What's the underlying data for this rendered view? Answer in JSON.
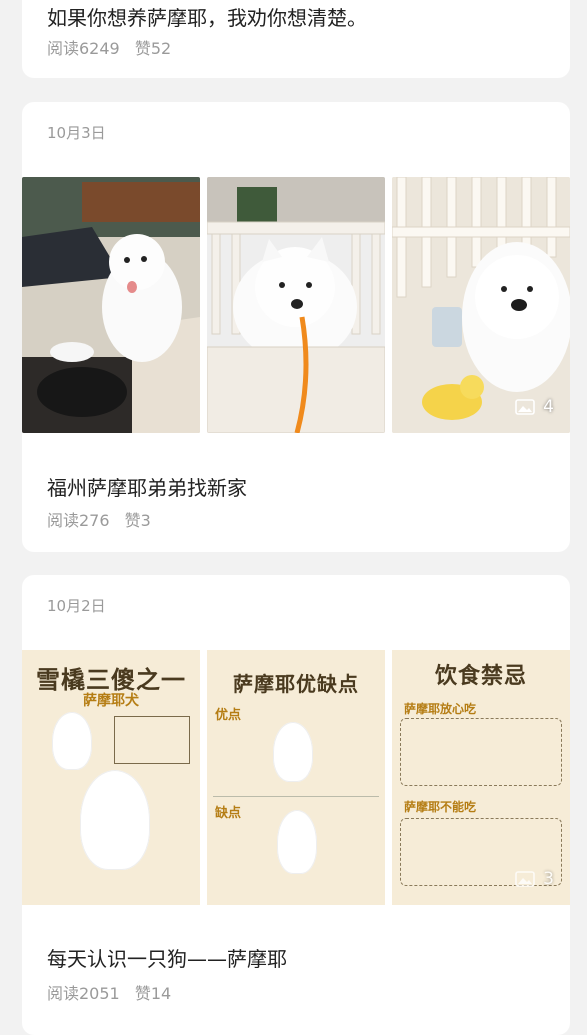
{
  "posts": [
    {
      "title": "如果你想养萨摩耶，我劝你想清楚。",
      "reads": "阅读6249",
      "likes": "赞52"
    },
    {
      "date": "10月3日",
      "title": "福州萨摩耶弟弟找新家",
      "reads": "阅读276",
      "likes": "赞3",
      "image_count": "4"
    },
    {
      "date": "10月2日",
      "title": "每天认识一只狗——萨摩耶",
      "reads": "阅读2051",
      "likes": "赞14",
      "image_count": "3",
      "posters": [
        {
          "title": "雪橇三傻之一",
          "subtitle": "萨摩耶犬"
        },
        {
          "title": "萨摩耶优缺点",
          "pros": "优点",
          "cons": "缺点"
        },
        {
          "title": "饮食禁忌",
          "can_eat": "萨摩耶放心吃",
          "cannot_eat": "萨摩耶不能吃"
        }
      ]
    }
  ]
}
